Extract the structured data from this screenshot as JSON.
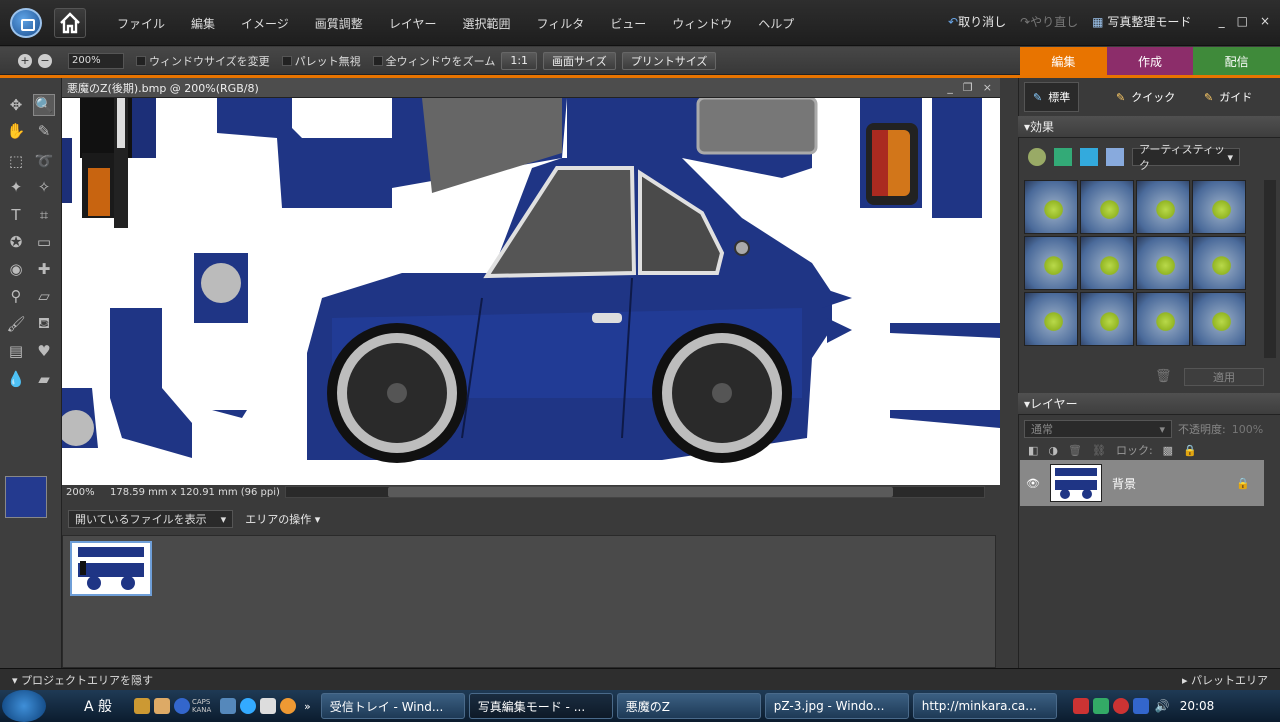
{
  "menubar": {
    "items": [
      "ファイル",
      "編集",
      "イメージ",
      "画質調整",
      "レイヤー",
      "選択範囲",
      "フィルタ",
      "ビュー",
      "ウィンドウ",
      "ヘルプ"
    ],
    "undo": "取り消し",
    "redo": "やり直し",
    "organizer": "写真整理モード",
    "win_controls": [
      "_",
      "□",
      "×"
    ]
  },
  "options": {
    "zoom": "200%",
    "resize_window": "ウィンドウサイズを変更",
    "ignore_palettes": "パレット無視",
    "zoom_all": "全ウィンドウをズーム",
    "btn_1to1": "1:1",
    "btn_screen": "画面サイズ",
    "btn_print": "プリントサイズ"
  },
  "mode_tabs": [
    {
      "label": "編集",
      "color": "#e87400"
    },
    {
      "label": "作成",
      "color": "#8c2d6a"
    },
    {
      "label": "配信",
      "color": "#3f8a3a"
    }
  ],
  "document": {
    "title": "悪魔のZ(後期).bmp @ 200%(RGB/8)",
    "zoom": "200%",
    "dimensions": "178.59 mm x 120.91 mm (96 ppi)",
    "foreground_color": "#243a8f"
  },
  "bin": {
    "show_dropdown": "開いているファイルを表示",
    "area_ops": "エリアの操作 ▾"
  },
  "panel": {
    "tabs": [
      "標準",
      "クイック",
      "ガイド"
    ],
    "effects_title": "効果",
    "effects_filter": "アーティスティック",
    "apply": "適用",
    "layers_title": "レイヤー",
    "blend_mode": "通常",
    "opacity_label": "不透明度:",
    "opacity_value": "100%",
    "lock_label": "ロック:",
    "layer_name": "背景"
  },
  "bottom": {
    "hide_project": "プロジェクトエリアを隠す",
    "palette_area": "パレットエリア"
  },
  "taskbar": {
    "ime": "A 般",
    "caps": "CAPS KANA",
    "items": [
      "受信トレイ - Wind...",
      "写真編集モード - ...",
      "悪魔のZ",
      "pZ-3.jpg - Windo...",
      "http://minkara.ca..."
    ],
    "clock": "20:08"
  }
}
